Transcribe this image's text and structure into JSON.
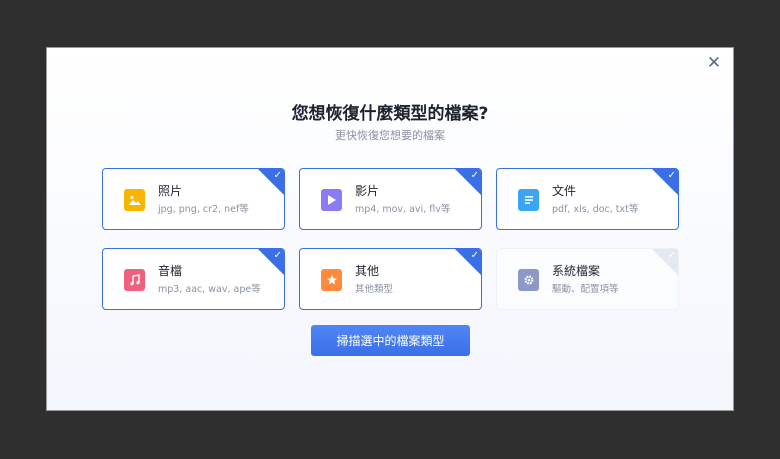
{
  "dialog": {
    "title": "您想恢復什麼類型的檔案?",
    "subtitle": "更快恢復您想要的檔案",
    "close_icon": "close-icon",
    "scan_button": "掃描選中的檔案類型"
  },
  "colors": {
    "accent": "#3a6fe8",
    "photo": "#f7b500",
    "video": "#8b7cf6",
    "document": "#3aa6f5",
    "audio": "#f0607f",
    "other": "#ff8a3d",
    "system": "#8c98c8"
  },
  "file_types": [
    {
      "name": "照片",
      "desc": "jpg, png, cr2, nef等",
      "icon": "image-icon",
      "selected": true
    },
    {
      "name": "影片",
      "desc": "mp4, mov, avi, flv等",
      "icon": "play-icon",
      "selected": true
    },
    {
      "name": "文件",
      "desc": "pdf, xls, doc, txt等",
      "icon": "document-icon",
      "selected": true
    },
    {
      "name": "音檔",
      "desc": "mp3, aac, wav, ape等",
      "icon": "music-note-icon",
      "selected": true
    },
    {
      "name": "其他",
      "desc": "其他類型",
      "icon": "star-icon",
      "selected": true
    },
    {
      "name": "系統檔案",
      "desc": "驅動、配置項等",
      "icon": "gear-icon",
      "selected": false
    }
  ]
}
